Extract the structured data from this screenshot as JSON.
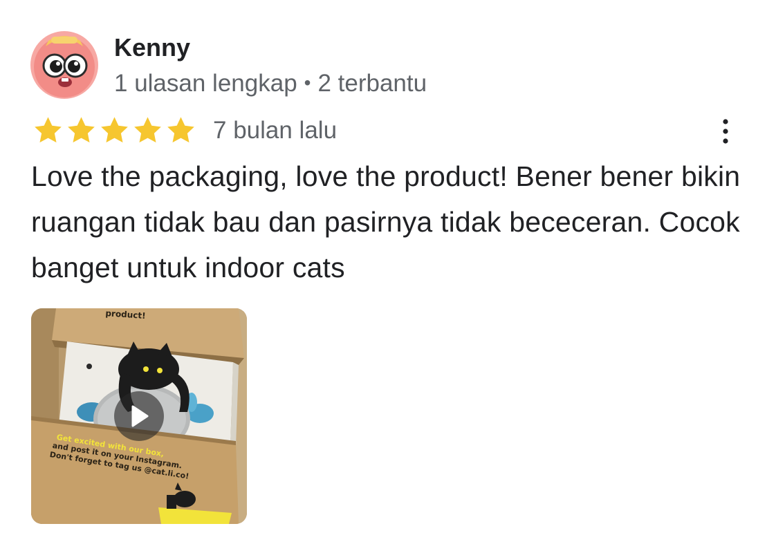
{
  "reviewer": {
    "name": "Kenny",
    "reviews_count": "1 ulasan lengkap",
    "separator": "•",
    "helpful_count": "2 terbantu"
  },
  "review": {
    "rating": 5,
    "rating_max": 5,
    "date": "7 bulan lalu",
    "text": "Love the packaging, love the product! Bener bener bikin ruangan tidak bau dan pasirnya tidak bececeran. Cocok banget untuk indoor cats"
  },
  "media": {
    "type": "video",
    "box_texts": {
      "top": "product!",
      "line1": "Get excited with our box,",
      "line2": "and post it on your Instagram.",
      "line3": "Don't forget to tag us @cat.li.co!"
    }
  },
  "icons": {
    "star": "star-icon",
    "more": "more-vert-icon",
    "play": "play-icon"
  },
  "colors": {
    "star": "#F6C62F",
    "text": "#202124",
    "meta": "#5F6368"
  }
}
